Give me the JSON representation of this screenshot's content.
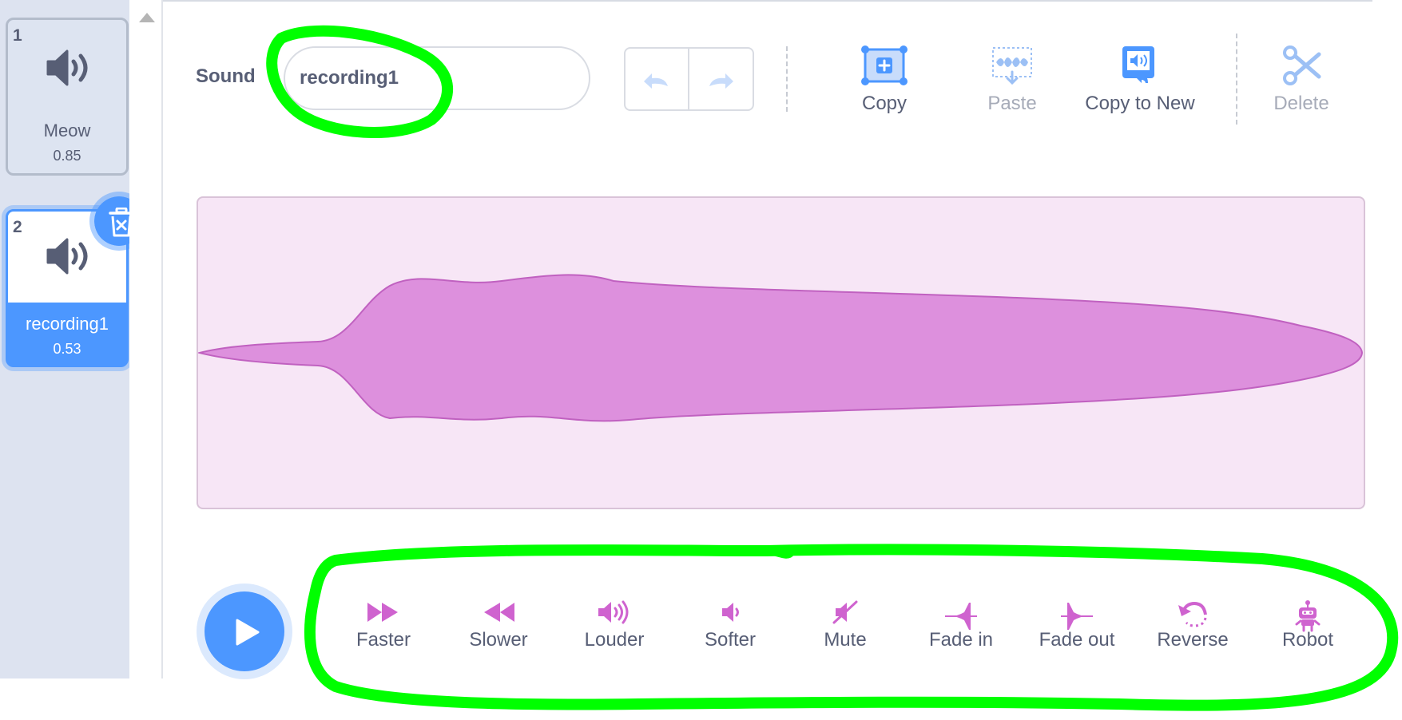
{
  "sound_list": {
    "items": [
      {
        "number": "1",
        "name": "Meow",
        "duration": "0.85",
        "selected": false
      },
      {
        "number": "2",
        "name": "recording1",
        "duration": "0.53",
        "selected": true
      }
    ]
  },
  "editor": {
    "sound_label": "Sound",
    "sound_name": "recording1",
    "tools": {
      "copy": "Copy",
      "paste": "Paste",
      "copy_to_new": "Copy to New",
      "delete": "Delete"
    }
  },
  "effects": [
    {
      "label": "Faster",
      "icon": "faster-icon"
    },
    {
      "label": "Slower",
      "icon": "slower-icon"
    },
    {
      "label": "Louder",
      "icon": "louder-icon"
    },
    {
      "label": "Softer",
      "icon": "softer-icon"
    },
    {
      "label": "Mute",
      "icon": "mute-icon"
    },
    {
      "label": "Fade in",
      "icon": "fade-in-icon"
    },
    {
      "label": "Fade out",
      "icon": "fade-out-icon"
    },
    {
      "label": "Reverse",
      "icon": "reverse-icon"
    },
    {
      "label": "Robot",
      "icon": "robot-icon"
    }
  ],
  "colors": {
    "accent": "#4c97ff",
    "sound_magenta": "#cf63cf",
    "waveform_fill": "#dd90dd",
    "waveform_bg": "#f7e6f6",
    "annotation_green": "#00ff00",
    "text": "#575e75"
  }
}
